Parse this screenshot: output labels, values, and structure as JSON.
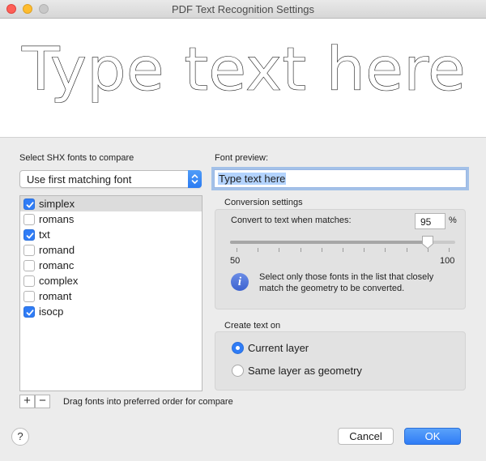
{
  "window": {
    "title": "PDF Text Recognition Settings"
  },
  "preview": {
    "text": "Type text here"
  },
  "left": {
    "section_label": "Select SHX fonts to compare",
    "popup_value": "Use first matching font",
    "fonts": [
      {
        "name": "simplex",
        "checked": true,
        "selected": true
      },
      {
        "name": "romans",
        "checked": false,
        "selected": false
      },
      {
        "name": "txt",
        "checked": true,
        "selected": false
      },
      {
        "name": "romand",
        "checked": false,
        "selected": false
      },
      {
        "name": "romanc",
        "checked": false,
        "selected": false
      },
      {
        "name": "complex",
        "checked": false,
        "selected": false
      },
      {
        "name": "romant",
        "checked": false,
        "selected": false
      },
      {
        "name": "isocp",
        "checked": true,
        "selected": false
      }
    ],
    "add_label": "+",
    "remove_label": "−",
    "drag_hint": "Drag fonts into preferred order for compare"
  },
  "right": {
    "font_preview_label": "Font preview:",
    "font_preview_value": "Type text here",
    "conversion_label": "Conversion settings",
    "convert_label": "Convert to text when matches:",
    "match_value": "95",
    "percent_sign": "%",
    "slider": {
      "min": 50,
      "max": 100,
      "value": 95,
      "min_label": "50",
      "max_label": "100"
    },
    "info_text": "Select only those fonts in the list that closely match the geometry to be converted.",
    "create_label": "Create text on",
    "options": [
      {
        "label": "Current layer",
        "selected": true
      },
      {
        "label": "Same layer as geometry",
        "selected": false
      }
    ]
  },
  "footer": {
    "help_label": "?",
    "cancel_label": "Cancel",
    "ok_label": "OK"
  },
  "colors": {
    "accent": "#2f7cf6",
    "close": "#fe5f57",
    "minimize": "#febc2e",
    "maximize": "#c8c8c8"
  },
  "icons": {
    "info": "info-icon",
    "help": "question-mark-icon",
    "popup": "chevron-updown-icon",
    "check": "checkmark-icon"
  }
}
